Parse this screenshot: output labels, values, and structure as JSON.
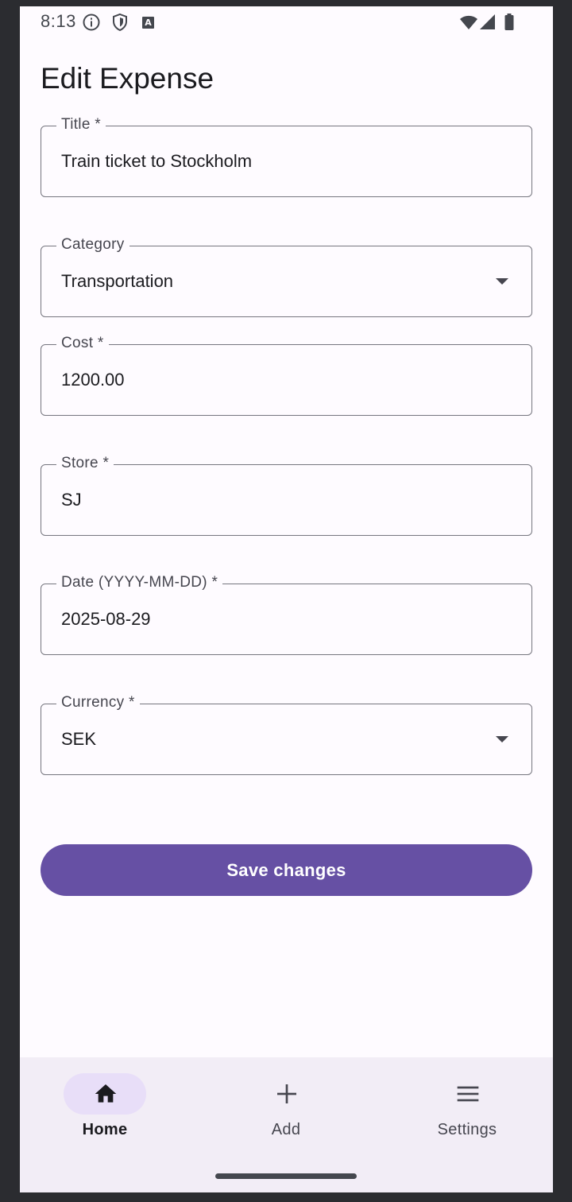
{
  "status_bar": {
    "time": "8:13",
    "icons": [
      "info-icon",
      "shield-icon",
      "keyboard-a-icon",
      "wifi-icon",
      "signal-icon",
      "battery-icon"
    ]
  },
  "page": {
    "title": "Edit Expense"
  },
  "fields": [
    {
      "label": "Title *",
      "value": "Train ticket to Stockholm",
      "type": "text"
    },
    {
      "label": "Category",
      "value": "Transportation",
      "type": "dropdown"
    },
    {
      "label": "Cost *",
      "value": "1200.00",
      "type": "text"
    },
    {
      "label": "Store *",
      "value": "SJ",
      "type": "text"
    },
    {
      "label": "Date (YYYY-MM-DD) *",
      "value": "2025-08-29",
      "type": "text"
    },
    {
      "label": "Currency *",
      "value": "SEK",
      "type": "dropdown"
    }
  ],
  "actions": {
    "save_label": "Save changes"
  },
  "bottom_nav": {
    "items": [
      {
        "label": "Home",
        "icon": "home-icon",
        "active": true
      },
      {
        "label": "Add",
        "icon": "plus-icon",
        "active": false
      },
      {
        "label": "Settings",
        "icon": "menu-icon",
        "active": false
      }
    ]
  },
  "colors": {
    "primary": "#6650a4",
    "nav_background": "#f2edf6",
    "nav_indicator": "#e8def8",
    "surface": "#fefbff",
    "outline": "#76767f"
  }
}
